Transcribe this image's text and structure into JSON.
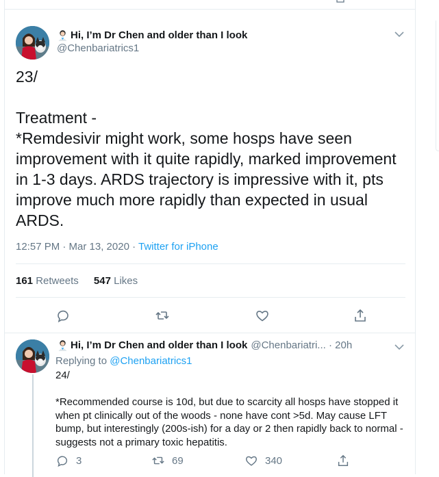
{
  "main_tweet": {
    "display_name": "Hi, I’m Dr Chen and older than I look",
    "handle": "@Chenbariatrics1",
    "text": "23/\n\nTreatment -\n*Remdesivir might work, some hosps have seen improvement with it quite rapidly, marked improvement in 1-3 days. ARDS trajectory is impressive with it, pts improve much more rapidly than expected in usual ARDS.",
    "timestamp": "12:57 PM · Mar 13, 2020 · ",
    "source": "Twitter for iPhone",
    "retweets_count": "161",
    "retweets_label": "Retweets",
    "likes_count": "547",
    "likes_label": "Likes"
  },
  "reply_tweet": {
    "display_name": "Hi, I’m Dr Chen and older than I look",
    "handle_time": "@Chenbariatri... · 20h",
    "replying_prefix": "Replying to ",
    "replying_handle": "@Chenbariatrics1",
    "text": "24/\n\n*Recommended course is 10d, but due to scarcity all hosps have stopped it when pt clinically out of the woods - none have cont >5d. May cause LFT bump, but interestingly (200s-ish) for a day or 2 then rapidly back to normal - suggests not a primary toxic hepatitis.",
    "reply_count": "3",
    "retweet_count": "69",
    "like_count": "340"
  },
  "colors": {
    "accent": "#1da1f2",
    "secondary_text": "#657786",
    "border": "#e6ecf0"
  }
}
